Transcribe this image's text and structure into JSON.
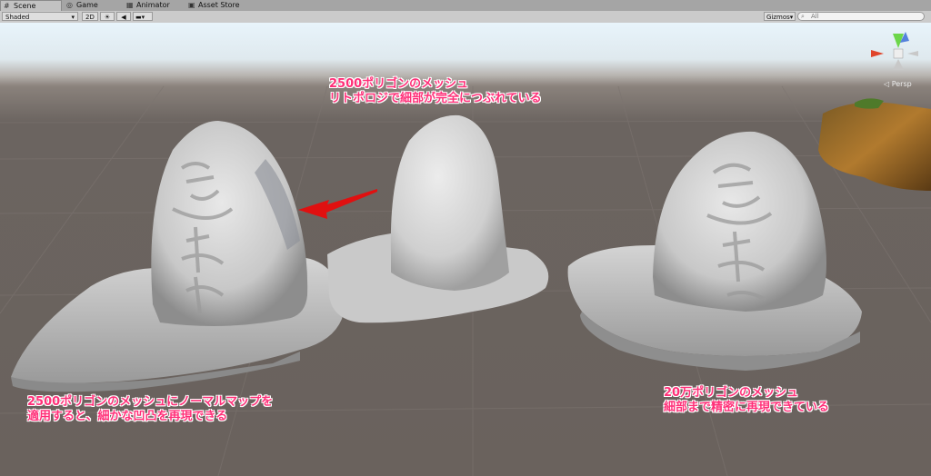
{
  "tabs": [
    {
      "label": "Scene",
      "icon": "scene-icon"
    },
    {
      "label": "Game",
      "icon": "game-icon"
    },
    {
      "label": "Animator",
      "icon": "animator-icon"
    },
    {
      "label": "Asset Store",
      "icon": "store-icon"
    }
  ],
  "toolbar": {
    "shading_mode": "Shaded",
    "mode_2d": "2D",
    "gizmos": "Gizmos",
    "search_placeholder": "All"
  },
  "scene": {
    "projection": "Persp",
    "captions": {
      "top_line1": "2500ポリゴンのメッシュ",
      "top_line2": "リトポロジで細部が完全につぶれている",
      "left_line1": "2500ポリゴンのメッシュにノーマルマップを",
      "left_line2": "適用すると、細かな凹凸を再現できる",
      "right_line1": "20万ポリゴンのメッシュ",
      "right_line2": "細部まで精密に再現できている"
    }
  },
  "colors": {
    "caption": "#ff2f78",
    "arrow": "#e01010"
  }
}
